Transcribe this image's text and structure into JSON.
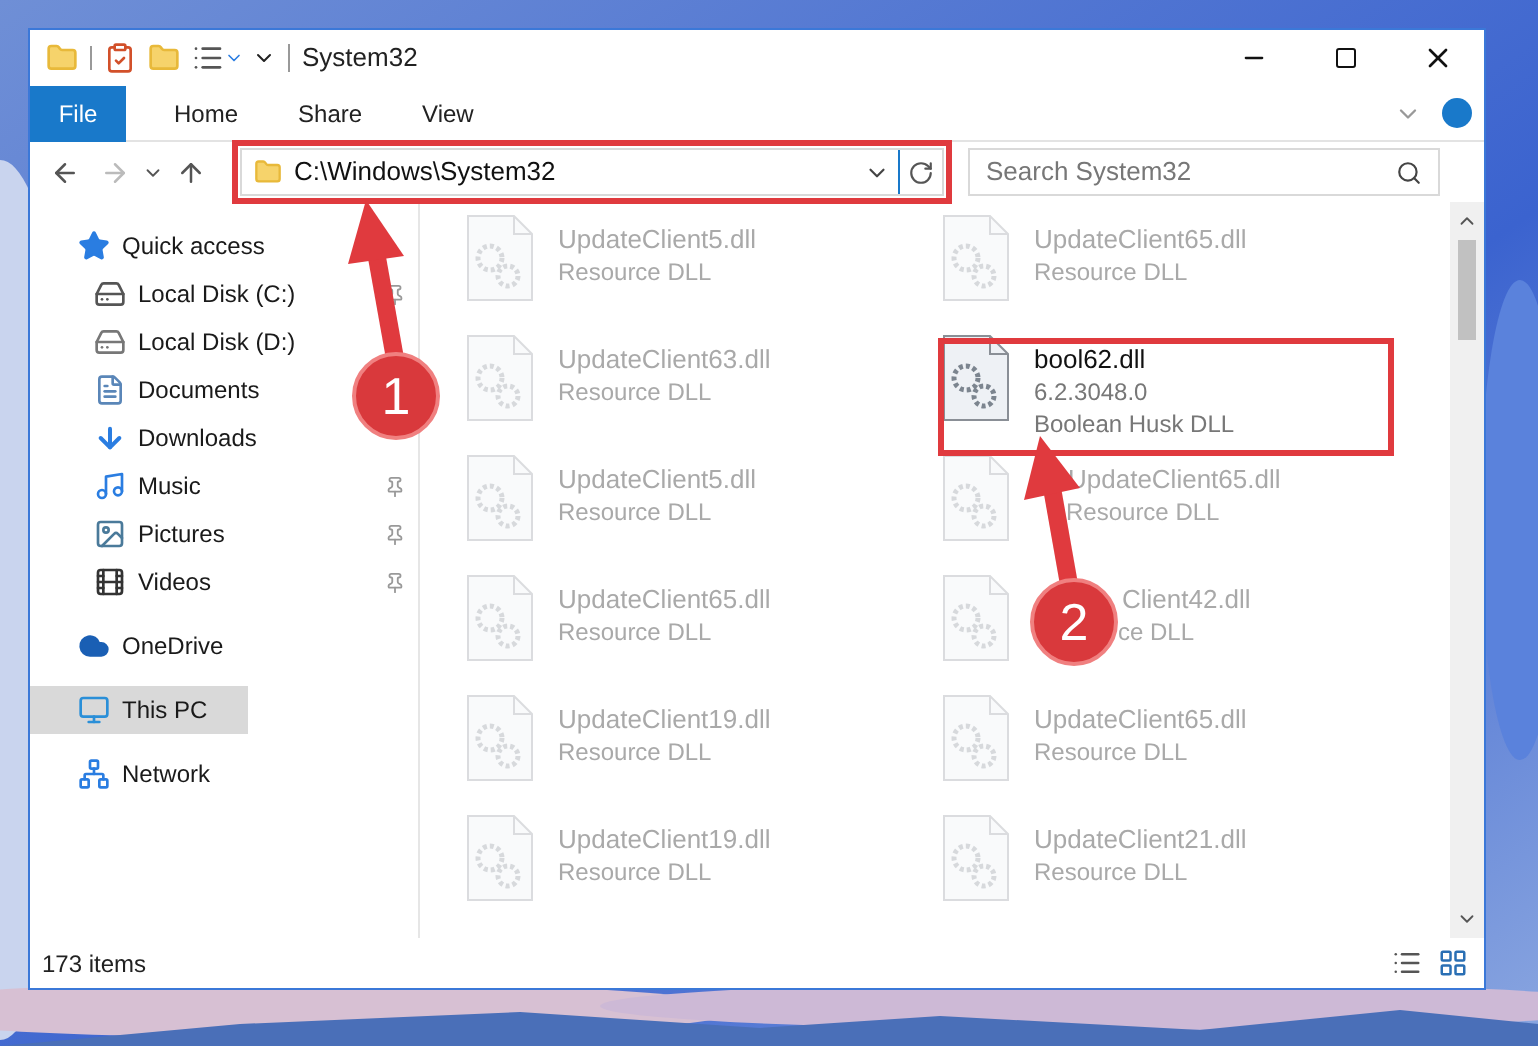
{
  "window": {
    "title": "System32"
  },
  "ribbon": {
    "tabs": [
      {
        "label": "File",
        "kind": "file"
      },
      {
        "label": "Home",
        "kind": "tab"
      },
      {
        "label": "Share",
        "kind": "tab"
      },
      {
        "label": "View",
        "kind": "tab"
      }
    ]
  },
  "address_bar": {
    "path": "C:\\Windows\\System32"
  },
  "search": {
    "placeholder": "Search System32"
  },
  "navigation": [
    {
      "label": "Quick access",
      "kind": "star",
      "selected": false,
      "children": [
        {
          "label": "Local Disk (C:)",
          "kind": "disk-c",
          "selected": false,
          "pinned": true
        },
        {
          "label": "Local Disk (D:)",
          "kind": "disk",
          "selected": false
        },
        {
          "label": "Documents",
          "kind": "documents",
          "selected": false
        },
        {
          "label": "Downloads",
          "kind": "downloads",
          "selected": false
        },
        {
          "label": "Music",
          "kind": "music",
          "selected": false,
          "pinned": true
        },
        {
          "label": "Pictures",
          "kind": "pictures",
          "selected": false,
          "pinned": true
        },
        {
          "label": "Videos",
          "kind": "videos",
          "selected": false,
          "pinned": true
        }
      ]
    },
    {
      "label": "OneDrive",
      "kind": "cloud",
      "selected": false
    },
    {
      "label": "This PC",
      "kind": "pc",
      "selected": true
    },
    {
      "label": "Network",
      "kind": "network",
      "selected": false
    }
  ],
  "files": [
    {
      "name": "UpdateClient5.dll",
      "description": "Resource DLL",
      "kind": "blurred"
    },
    {
      "name": "UpdateClient65.dll",
      "description": "Resource DLL",
      "kind": "blurred"
    },
    {
      "name": "UpdateClient63.dll",
      "description": "Resource DLL",
      "kind": "blurred"
    },
    {
      "name": "bool62.dll",
      "version": "6.2.3048.0",
      "description": "Boolean Husk DLL",
      "kind": "sharp"
    },
    {
      "name": "UpdateClient5.dll",
      "description": "Resource DLL",
      "kind": "blurred"
    },
    {
      "name": "UpdateClient65.dll",
      "description": "Resource DLL",
      "kind": "blurred"
    },
    {
      "name": "UpdateClient65.dll",
      "description": "Resource DLL",
      "kind": "blurred"
    },
    {
      "name": "Client42.dll",
      "description": "ce DLL",
      "kind": "blurred"
    },
    {
      "name": "UpdateClient19.dll",
      "description": "Resource DLL",
      "kind": "blurred"
    },
    {
      "name": "UpdateClient65.dll",
      "description": "Resource DLL",
      "kind": "blurred"
    },
    {
      "name": "UpdateClient19.dll",
      "description": "Resource DLL",
      "kind": "blurred"
    },
    {
      "name": "UpdateClient21.dll",
      "description": "Resource DLL",
      "kind": "blurred"
    }
  ],
  "status_bar": {
    "item_count": "173 items"
  },
  "annotations": [
    {
      "number": "1"
    },
    {
      "number": "2"
    }
  ]
}
